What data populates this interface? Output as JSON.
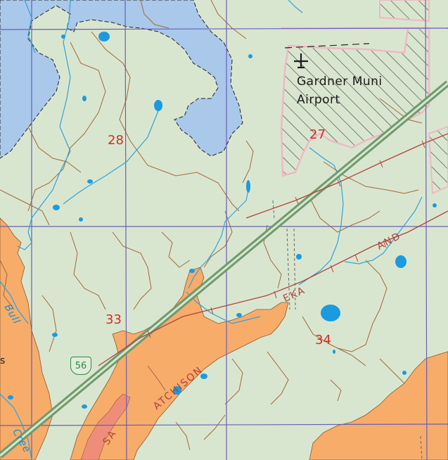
{
  "map": {
    "colors": {
      "land": "#d9e6cf",
      "water": "#a9c8ea",
      "water_feature": "#1a9be0",
      "urban": "#f7ac6a",
      "urban_dense": "#ee8e7a",
      "grid": "#6a5fb8",
      "contour": "#a0683a",
      "stream": "#2ea3dc",
      "railroad": "#b0433d",
      "airport_boundary": "#f0b8c4",
      "highway": "#6e9a6e"
    },
    "section_labels": [
      {
        "id": "sec-28",
        "text": "28"
      },
      {
        "id": "sec-27",
        "text": "27"
      },
      {
        "id": "sec-33",
        "text": "33"
      },
      {
        "id": "sec-34",
        "text": "34"
      }
    ],
    "airport": {
      "icon": "airport-icon",
      "line1": "Gardner Muni",
      "line2": "Airport"
    },
    "highway_shield": {
      "icon": "us-highway-shield",
      "number": "56"
    },
    "railroad_labels": {
      "topeka": "EKA",
      "and": "AND",
      "atchison": "ATCHISON",
      "santa": "SA"
    },
    "stream_label": "Bull",
    "stream_label_2": "Cree",
    "edge_letter": "s"
  }
}
